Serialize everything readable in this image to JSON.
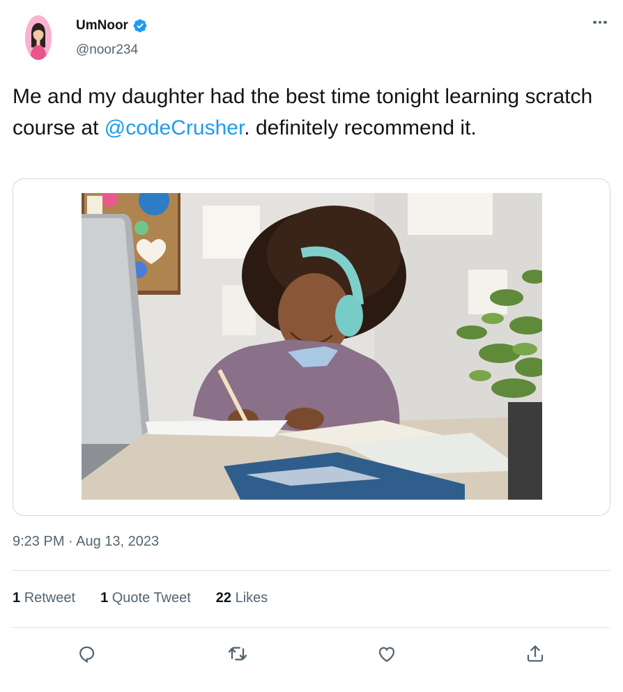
{
  "user": {
    "display_name": "UmNoor",
    "handle": "@noor234",
    "verified": true,
    "avatar_icon": "avatar-girl-icon"
  },
  "more_icon": "more-dots-icon",
  "tweet": {
    "text_before": "Me and my daughter had the best time tonight learning scratch course at ",
    "mention": "@codeCrusher",
    "text_after": ". definitely recommend it."
  },
  "media": {
    "description_icon": "photo-girl-studying"
  },
  "timestamp": "9:23 PM · Aug 13, 2023",
  "stats": {
    "retweets_count": "1",
    "retweets_label": "Retweet",
    "quotes_count": "1",
    "quotes_label": "Quote Tweet",
    "likes_count": "22",
    "likes_label": "Likes"
  },
  "actions": [
    "reply-icon",
    "retweet-icon",
    "like-icon",
    "share-icon"
  ],
  "colors": {
    "accent": "#1d9bf0",
    "muted": "#536471",
    "text": "#0f1419",
    "border": "#cfd9de"
  }
}
